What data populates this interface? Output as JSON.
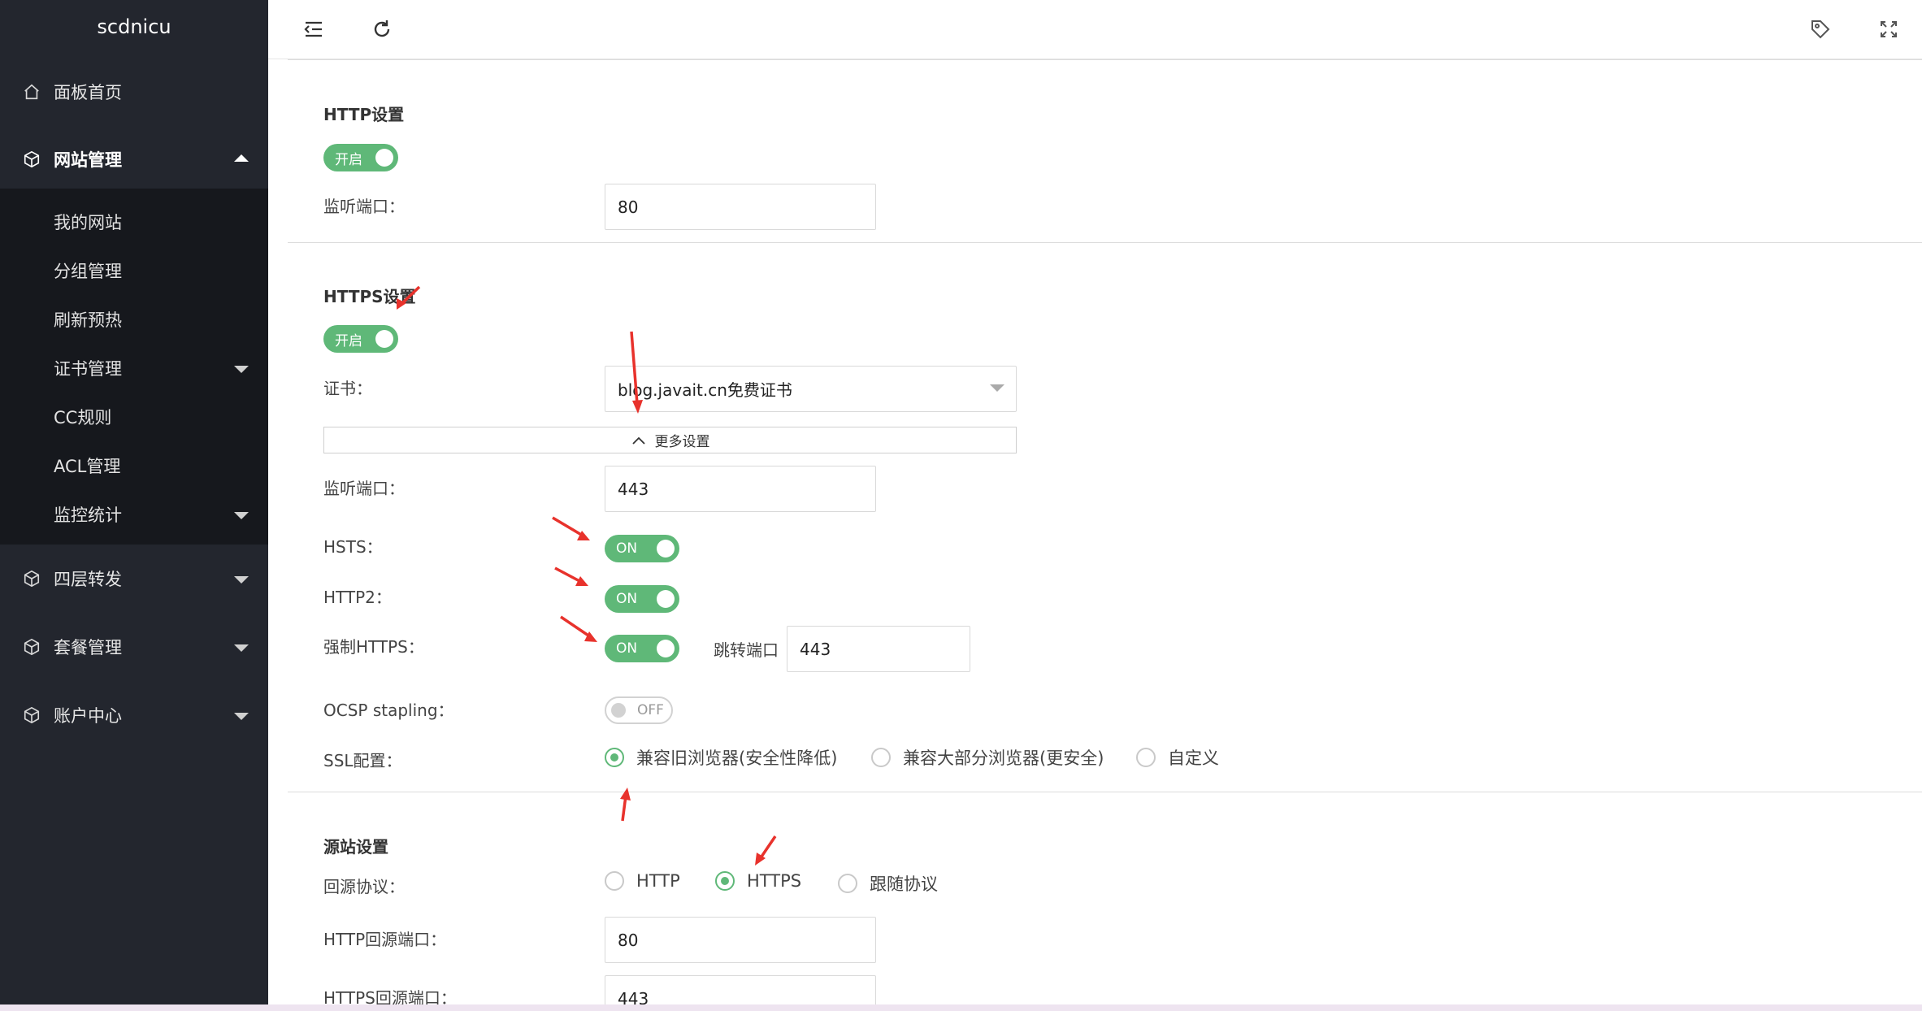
{
  "app": {
    "brand": "scdnicu"
  },
  "sidebar": {
    "items": [
      {
        "label": "面板首页",
        "icon": "home-icon"
      },
      {
        "label": "网站管理",
        "icon": "cube-icon",
        "expanded": true
      },
      {
        "label": "四层转发",
        "icon": "cube-icon"
      },
      {
        "label": "套餐管理",
        "icon": "cube-icon"
      },
      {
        "label": "账户中心",
        "icon": "cube-icon"
      }
    ],
    "submenu": [
      {
        "label": "我的网站"
      },
      {
        "label": "分组管理"
      },
      {
        "label": "刷新预热"
      },
      {
        "label": "证书管理"
      },
      {
        "label": "CC规则"
      },
      {
        "label": "ACL管理"
      },
      {
        "label": "监控统计"
      }
    ]
  },
  "header": {
    "icons": [
      "menu-fold-icon",
      "refresh-icon",
      "tag-icon",
      "fullscreen-icon"
    ]
  },
  "http": {
    "title": "HTTP设置",
    "switch": "开启",
    "port_label": "监听端口：",
    "port_value": "80"
  },
  "https": {
    "title": "HTTPS设置",
    "switch": "开启",
    "cert_label": "证书：",
    "cert_value": "blog.javait.cn免费证书",
    "more_settings": "更多设置",
    "port_label": "监听端口：",
    "port_value": "443",
    "hsts_label": "HSTS：",
    "hsts_state": "ON",
    "http2_label": "HTTP2：",
    "http2_state": "ON",
    "force_label": "强制HTTPS：",
    "force_state": "ON",
    "redirect_label": "跳转端口",
    "redirect_value": "443",
    "ocsp_label": "OCSP stapling：",
    "ocsp_state": "OFF",
    "ssl_label": "SSL配置：",
    "ssl_options": [
      "兼容旧浏览器(安全性降低)",
      "兼容大部分浏览器(更安全)",
      "自定义"
    ],
    "ssl_selected": "兼容旧浏览器(安全性降低)"
  },
  "origin": {
    "title": "源站设置",
    "protocol_label": "回源协议：",
    "protocol_options": [
      "HTTP",
      "HTTPS",
      "跟随协议"
    ],
    "protocol_selected": "HTTPS",
    "http_port_label": "HTTP回源端口：",
    "http_port_value": "80",
    "https_port_label": "HTTPS回源端口：",
    "https_port_value": "443"
  },
  "colors": {
    "accent": "#5fb878",
    "sidebar": "#23262e",
    "submenu": "#16181d",
    "annotation": "#e8322c"
  }
}
